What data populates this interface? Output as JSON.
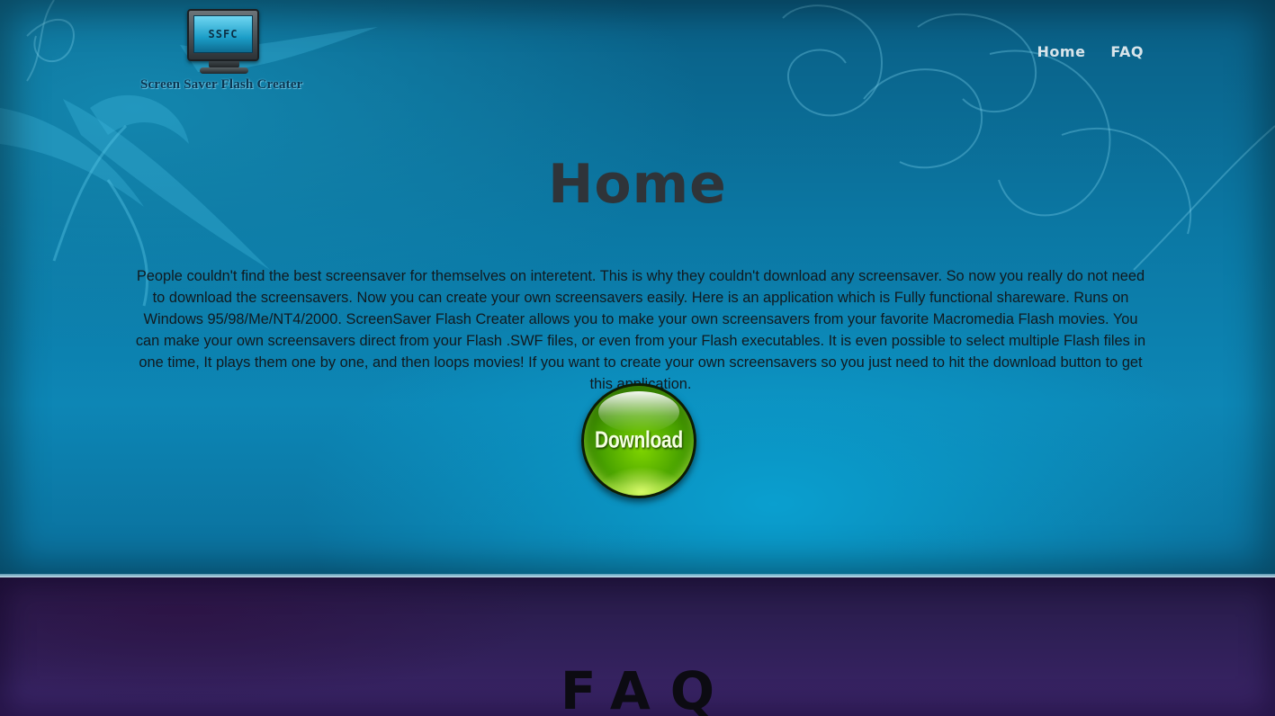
{
  "brand": {
    "logo_text": "Screen Saver Flash Creater",
    "screen_text": "SSFC"
  },
  "nav": {
    "items": [
      {
        "label": "Home"
      },
      {
        "label": "FAQ"
      }
    ]
  },
  "hero": {
    "title": "Home",
    "body": "People couldn't find the best screensaver for themselves on interetent. This is why they couldn't download any screensaver. So now you really do not need to download the screensavers. Now you can create your own screensavers easily. Here is an application which is Fully functional shareware. Runs on Windows 95/98/Me/NT4/2000. ScreenSaver Flash Creater allows you to make your own screensavers from your favorite Macromedia Flash movies. You can make your own screensavers direct from your Flash .SWF files, or even from your Flash executables. It is even possible to select multiple Flash files in one time, It plays them one by one, and then loops movies! If you want to create your own screensavers so you just need to hit the download button to get this application.",
    "download_label": "Download"
  },
  "faq": {
    "title": "FAQ"
  },
  "colors": {
    "hero_bg": "#0b78a4",
    "faq_bg": "#2e1f55",
    "download_green": "#4aa300",
    "nav_text": "#d8e4ea"
  },
  "icons": {
    "logo": "monitor-icon",
    "download": "download-button-orb"
  }
}
